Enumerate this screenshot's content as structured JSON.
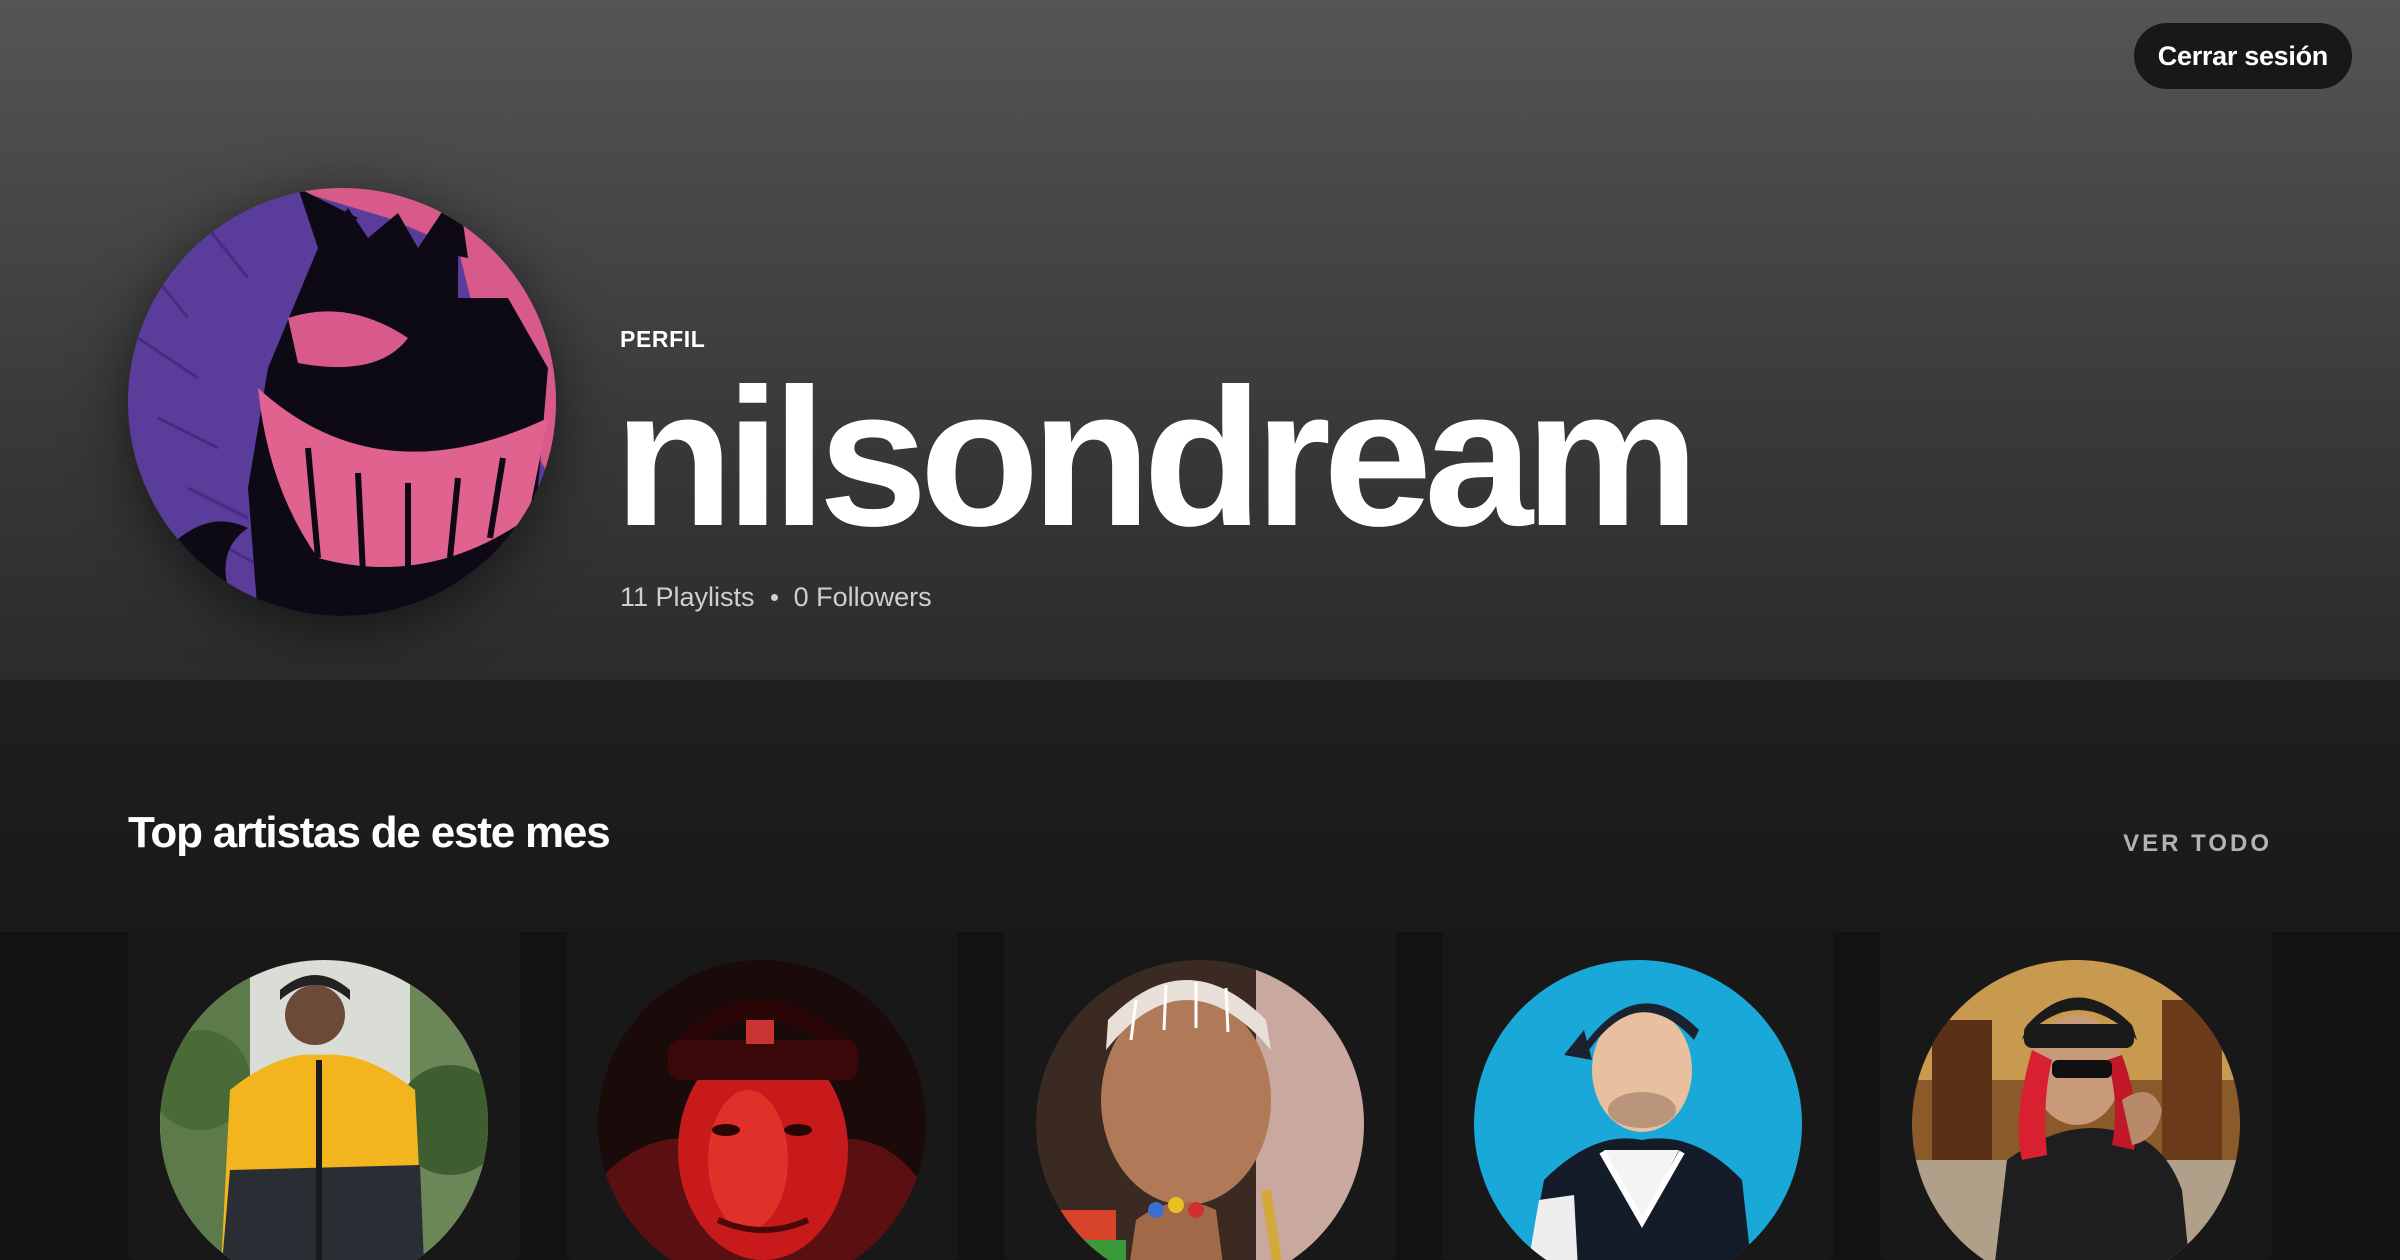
{
  "header": {
    "logout_label": "Cerrar sesión",
    "profile_kind": "PERFIL",
    "username": "nilsondream",
    "playlists_count": "11 Playlists",
    "followers_count": "0 Followers",
    "avatar_icon": "ghost-pokemon-avatar"
  },
  "top_artists": {
    "title": "Top artistas de este mes",
    "see_all_label": "VER TODO",
    "artists": [
      {
        "image": "artist-yellow-jacket-photo"
      },
      {
        "image": "artist-red-light-beanie-photo"
      },
      {
        "image": "artist-braids-gold-chain-photo"
      },
      {
        "image": "artist-blue-background-cap-photo"
      },
      {
        "image": "artist-red-hair-cap-photo"
      }
    ]
  },
  "colors": {
    "header_top": "#555555",
    "header_bottom": "#2b2b2b",
    "background": "#121212",
    "card": "#181818",
    "muted_text": "#b3b3b3"
  }
}
